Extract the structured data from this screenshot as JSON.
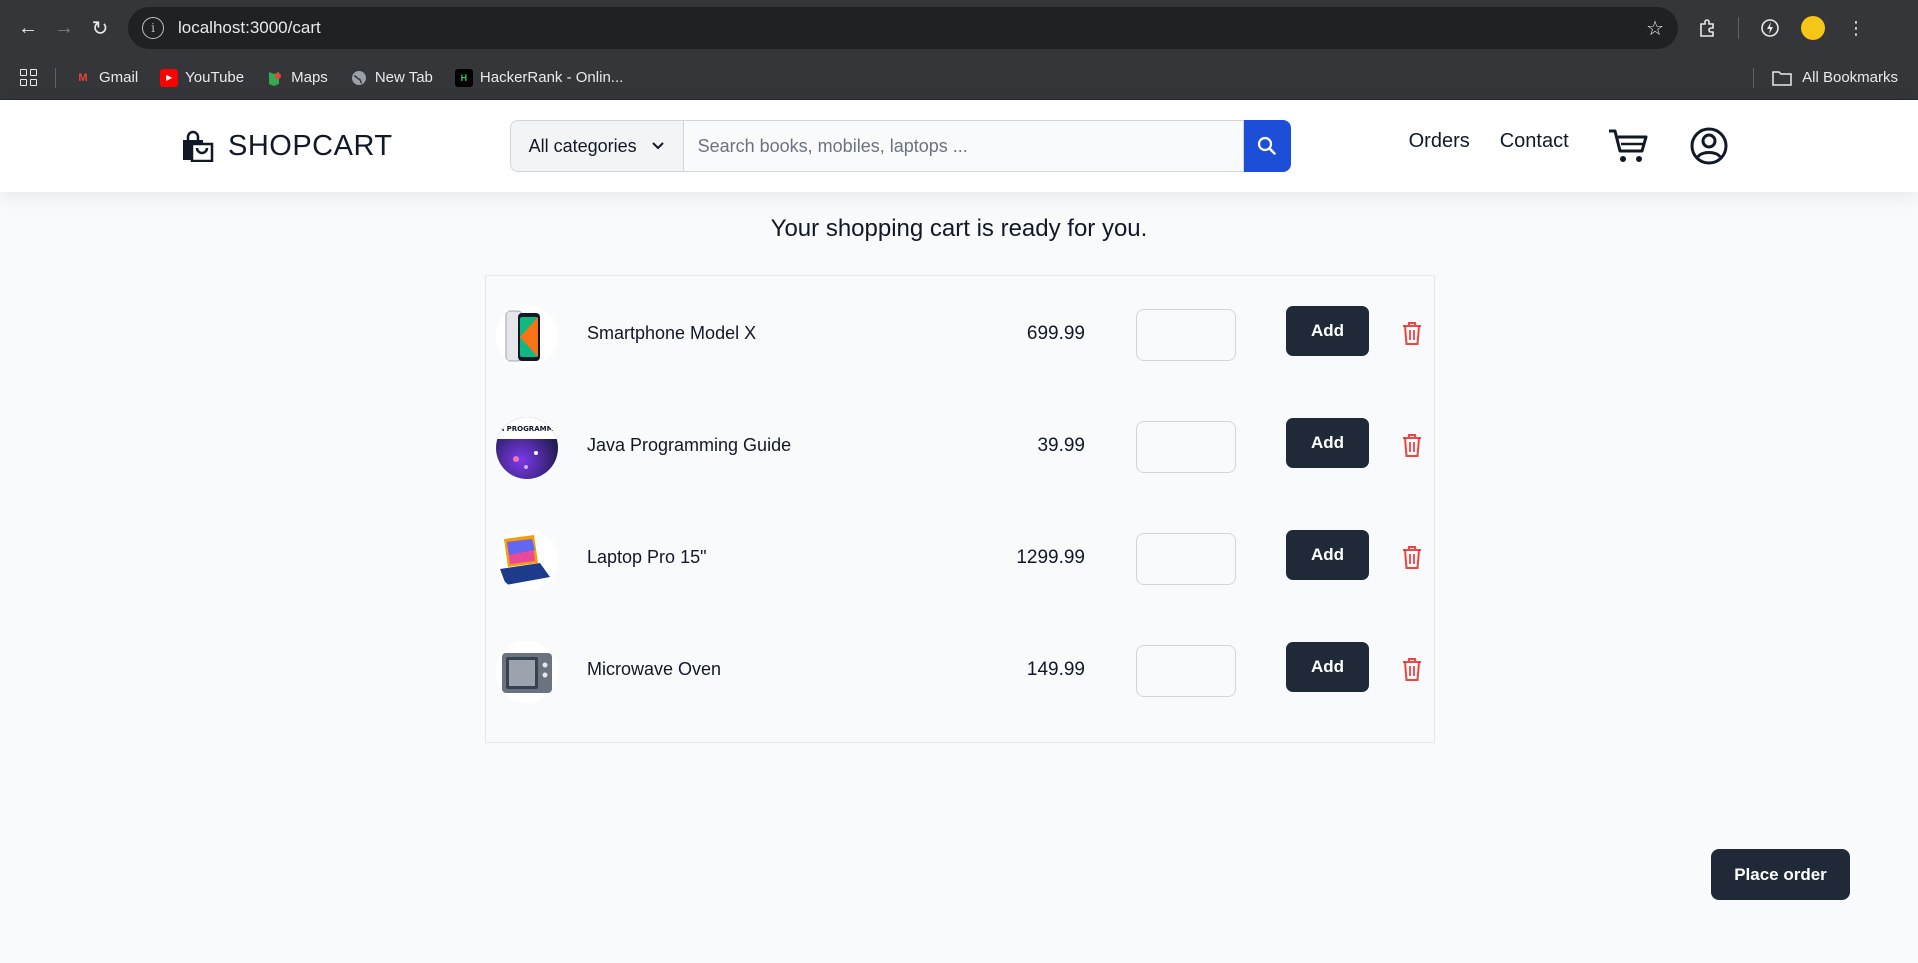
{
  "browser": {
    "url": "localhost:3000/cart",
    "bookmarks": [
      {
        "label": "Gmail",
        "icon": "gmail-icon"
      },
      {
        "label": "YouTube",
        "icon": "youtube-icon"
      },
      {
        "label": "Maps",
        "icon": "maps-icon"
      },
      {
        "label": "New Tab",
        "icon": "globe-icon"
      },
      {
        "label": "HackerRank - Onlin...",
        "icon": "hackerrank-icon"
      }
    ],
    "all_bookmarks": "All Bookmarks"
  },
  "header": {
    "brand": "SHOPCART",
    "category_select": "All categories",
    "search_placeholder": "Search books, mobiles, laptops ...",
    "nav": {
      "orders": "Orders",
      "contact": "Contact"
    }
  },
  "cart": {
    "heading": "Your shopping cart is ready for you.",
    "items": [
      {
        "name": "Smartphone Model X",
        "price": "699.99",
        "add_label": "Add"
      },
      {
        "name": "Java Programming Guide",
        "price": "39.99",
        "add_label": "Add",
        "cover_text": "JAVA PROGRAMMING"
      },
      {
        "name": "Laptop Pro 15\"",
        "price": "1299.99",
        "add_label": "Add"
      },
      {
        "name": "Microwave Oven",
        "price": "149.99",
        "add_label": "Add"
      }
    ],
    "place_order": "Place order"
  },
  "colors": {
    "accent_blue": "#1d4ed8",
    "button_dark": "#1f2937",
    "trash_red": "#ef4444"
  }
}
